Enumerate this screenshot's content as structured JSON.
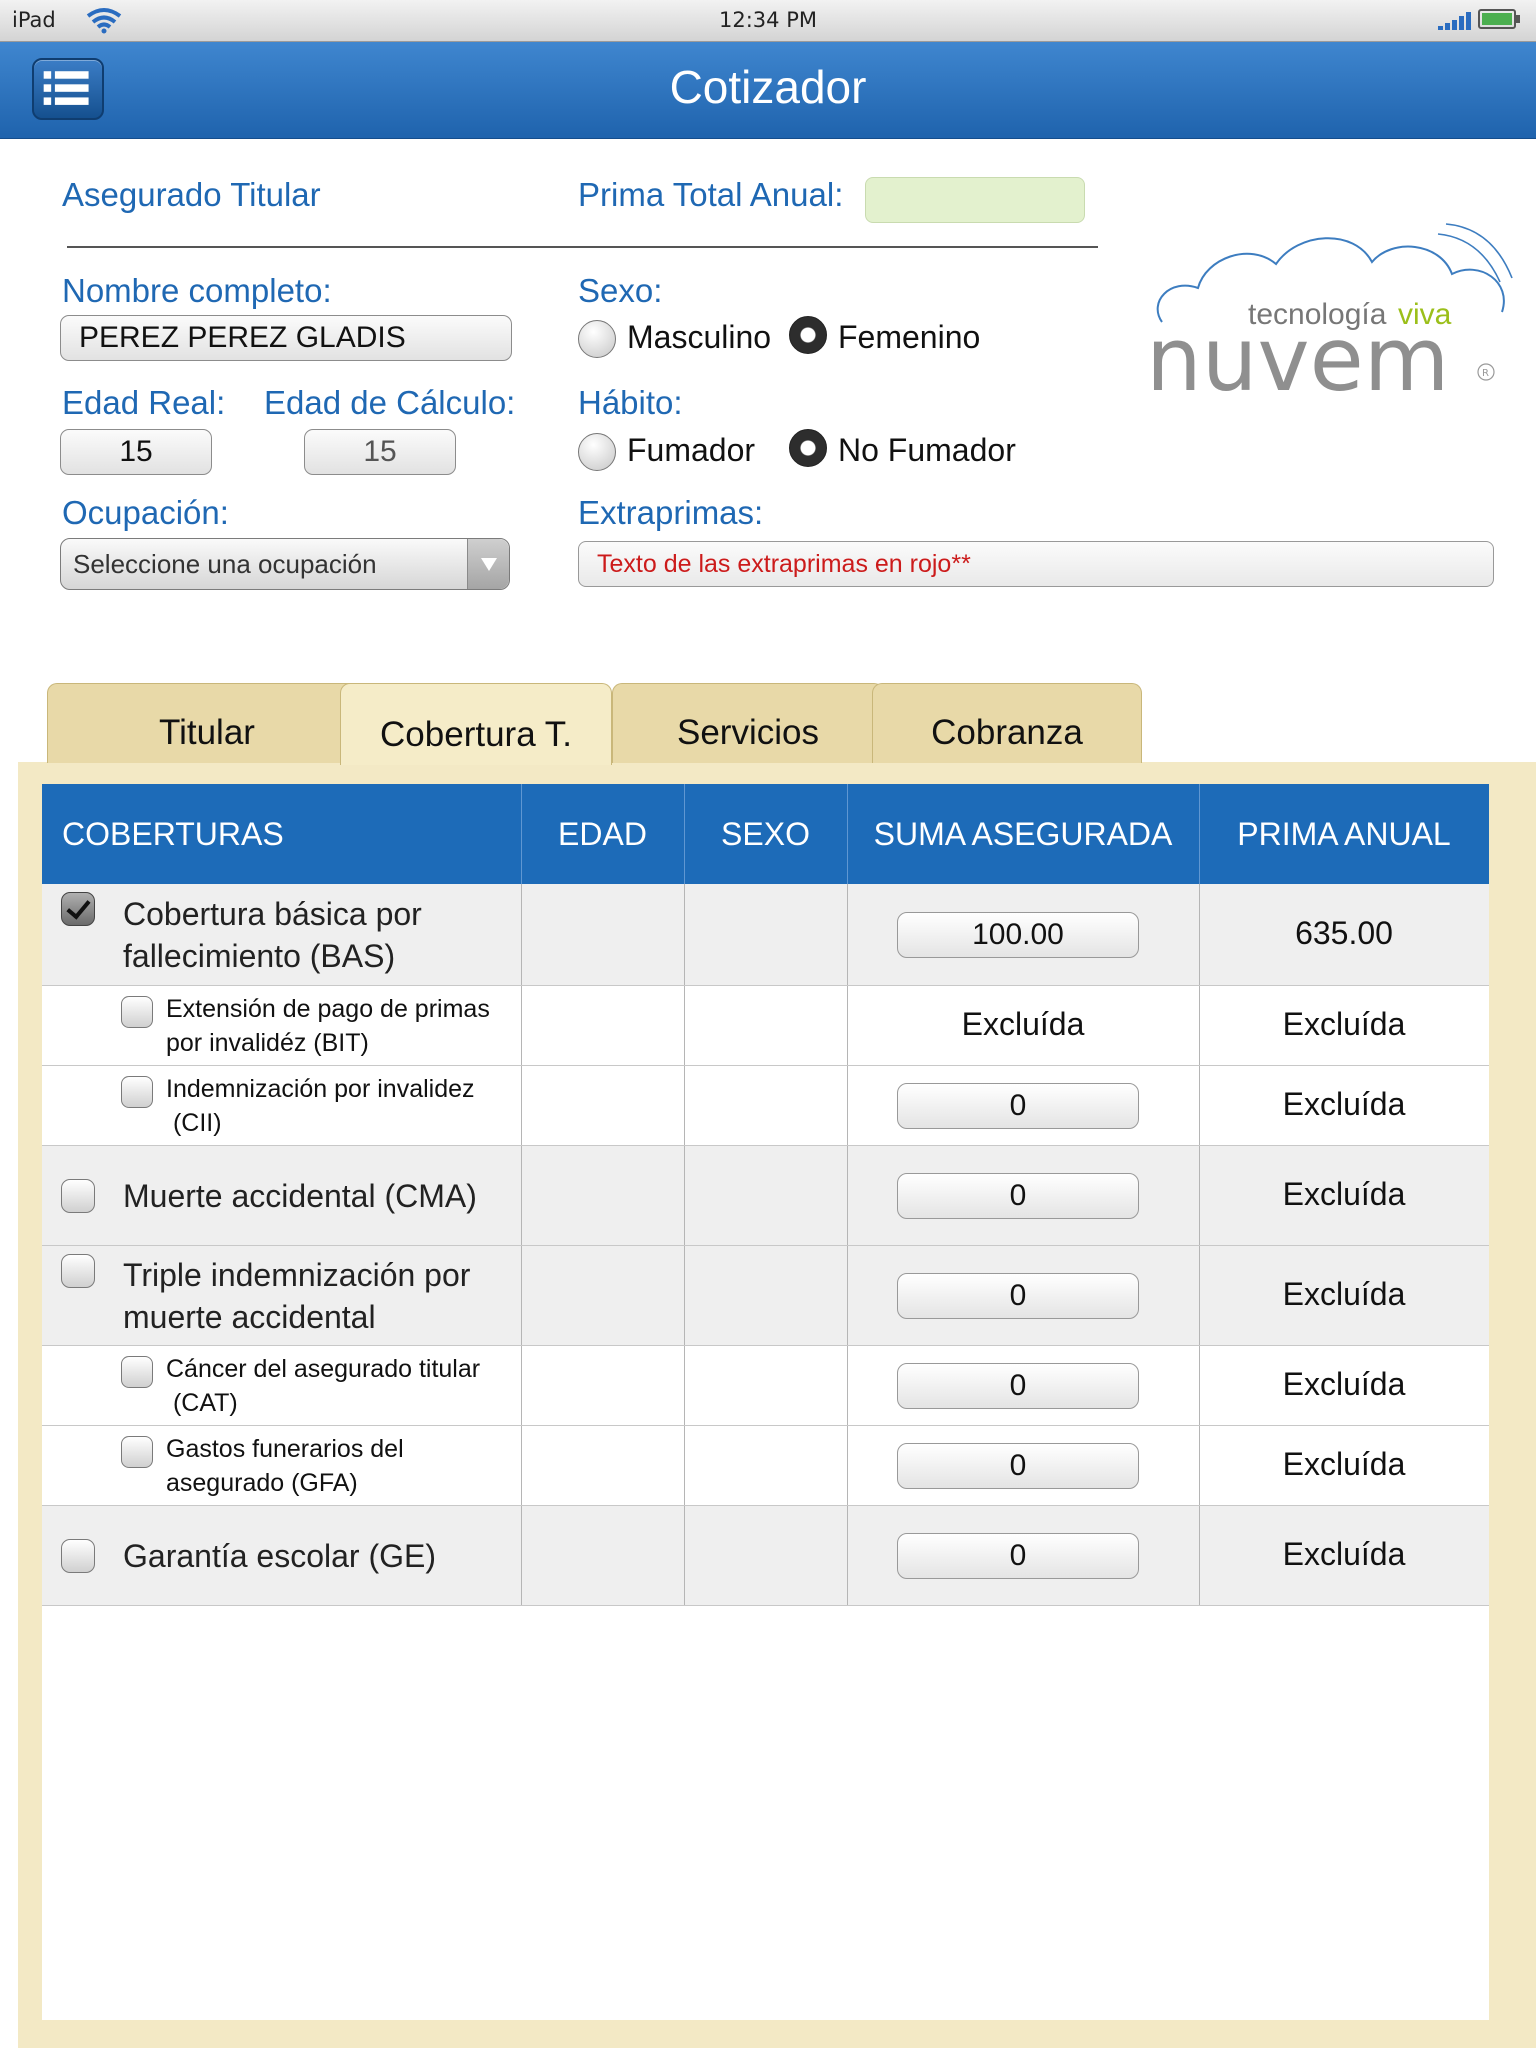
{
  "status_bar": {
    "carrier": "iPad",
    "time": "12:34 PM"
  },
  "header": {
    "title": "Cotizador"
  },
  "form": {
    "asegurado_titular_label": "Asegurado Titular",
    "prima_total_label": "Prima Total Anual:",
    "prima_total_value": "",
    "nombre_label": "Nombre completo:",
    "nombre_value": "PEREZ PEREZ GLADIS",
    "edad_real_label": "Edad Real:",
    "edad_real_value": "15",
    "edad_calculo_label": "Edad de Cálculo:",
    "edad_calculo_value": "15",
    "ocupacion_label": "Ocupación:",
    "ocupacion_value": "Seleccione una ocupación",
    "sexo_label": "Sexo:",
    "sexo_options": [
      "Masculino",
      "Femenino"
    ],
    "sexo_selected": "Femenino",
    "habito_label": "Hábito:",
    "habito_options": [
      "Fumador",
      "No Fumador"
    ],
    "habito_selected": "No Fumador",
    "extraprimas_label": "Extraprimas:",
    "extraprimas_value": "Texto de las extraprimas en rojo**"
  },
  "logo": {
    "tagline_1": "tecnología",
    "tagline_2": "viva",
    "brand": "nuvem",
    "registered": "R"
  },
  "tabs": [
    "Titular",
    "Cobertura T.",
    "Servicios",
    "Cobranza"
  ],
  "active_tab": "Cobertura T.",
  "table": {
    "headers": [
      "COBERTURAS",
      "EDAD",
      "SEXO",
      "SUMA ASEGURADA",
      "PRIMA ANUAL"
    ],
    "rows": [
      {
        "lines": [
          "Cobertura básica por",
          "fallecimiento (BAS)"
        ],
        "checked": true,
        "suma": "100.00",
        "suma_is_input": true,
        "prima": "635.00"
      },
      {
        "lines": [
          "Extensión de pago de primas",
          "por invalidéz (BIT)"
        ],
        "checked": false,
        "suma": "Excluída",
        "suma_is_input": false,
        "prima": "Excluída"
      },
      {
        "lines": [
          "Indemnización por invalidez",
          " (CII)"
        ],
        "checked": false,
        "suma": "0",
        "suma_is_input": true,
        "prima": "Excluída"
      },
      {
        "lines": [
          "Muerte accidental (CMA)"
        ],
        "checked": false,
        "suma": "0",
        "suma_is_input": true,
        "prima": "Excluída"
      },
      {
        "lines": [
          "Triple indemnización por",
          "muerte accidental"
        ],
        "checked": false,
        "suma": "0",
        "suma_is_input": true,
        "prima": "Excluída"
      },
      {
        "lines": [
          "Cáncer del asegurado titular",
          " (CAT)"
        ],
        "checked": false,
        "suma": "0",
        "suma_is_input": true,
        "prima": "Excluída"
      },
      {
        "lines": [
          "Gastos funerarios del",
          "asegurado (GFA)"
        ],
        "checked": false,
        "suma": "0",
        "suma_is_input": true,
        "prima": "Excluída"
      },
      {
        "lines": [
          "Garantía escolar (GE)"
        ],
        "checked": false,
        "suma": "0",
        "suma_is_input": true,
        "prima": "Excluída"
      }
    ]
  }
}
